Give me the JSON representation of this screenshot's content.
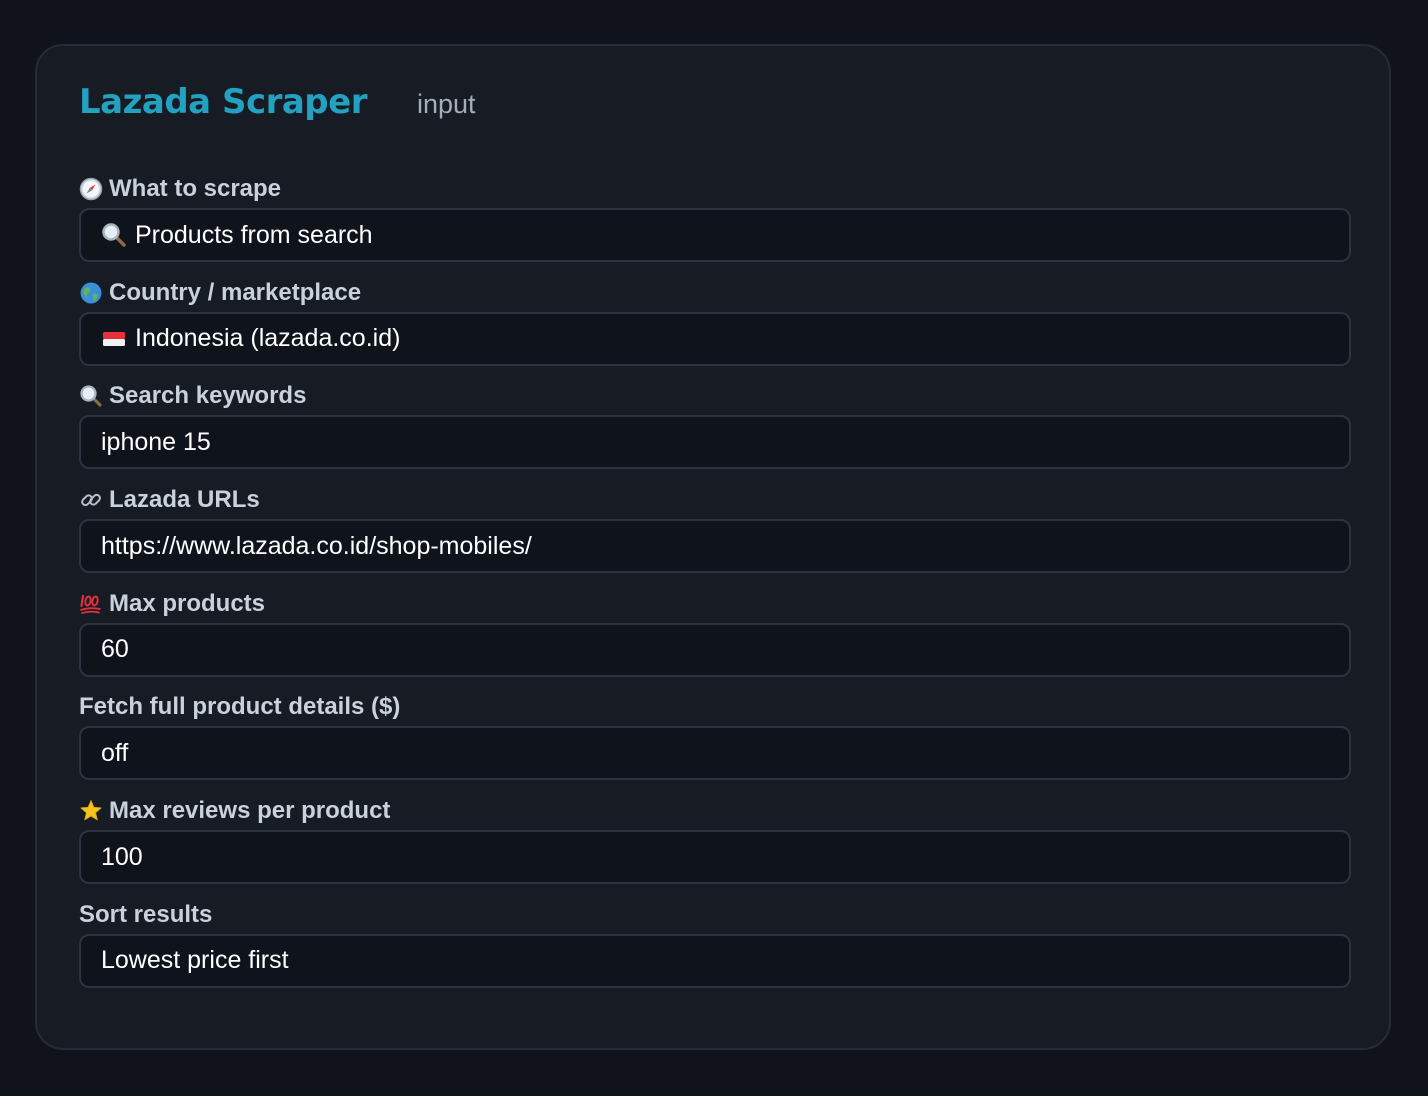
{
  "header": {
    "title": "Lazada Scraper",
    "subtitle": "input"
  },
  "fields": [
    {
      "label": "What to scrape",
      "label_icon": "compass-icon",
      "value": "Products from search",
      "value_icon": "magnifier-icon"
    },
    {
      "label": "Country / marketplace",
      "label_icon": "globe-icon",
      "value": "Indonesia (lazada.co.id)",
      "value_icon": "indonesia-flag-icon"
    },
    {
      "label": "Search keywords",
      "label_icon": "magnifier-icon",
      "value": "iphone 15"
    },
    {
      "label": "Lazada URLs",
      "label_icon": "link-icon",
      "value": "https://www.lazada.co.id/shop-mobiles/"
    },
    {
      "label": "Max products",
      "label_icon": "hundred-points-icon",
      "value": "60"
    },
    {
      "label": "Fetch full product details ($)",
      "value": "off"
    },
    {
      "label": "Max reviews per product",
      "label_icon": "star-icon",
      "value": "100"
    },
    {
      "label": "Sort results",
      "value": "Lowest price first"
    }
  ],
  "colors": {
    "background": "#10131b",
    "card": "#161b24",
    "accent": "#22a1c0",
    "field_bg": "#0f131b",
    "field_border": "#2c3340"
  }
}
